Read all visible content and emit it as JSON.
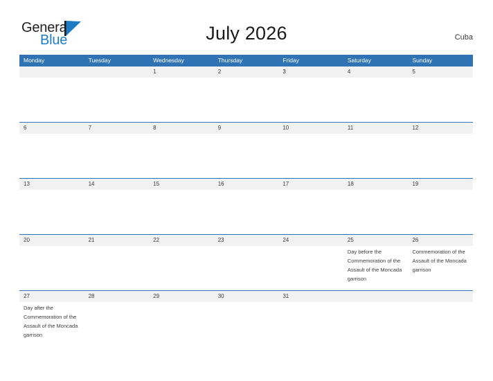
{
  "brand": {
    "name_part1": "General",
    "name_part2": "Blue",
    "flag_color": "#1f7ac4"
  },
  "header": {
    "title": "July 2026",
    "region": "Cuba"
  },
  "theme": {
    "header_blue": "#2f73b4",
    "band_gray": "#f1f1f1",
    "text_gray": "#3b3b3b"
  },
  "calendar": {
    "weekdays": [
      "Monday",
      "Tuesday",
      "Wednesday",
      "Thursday",
      "Friday",
      "Saturday",
      "Sunday"
    ],
    "weeks": [
      [
        {
          "day": "",
          "events": []
        },
        {
          "day": "",
          "events": []
        },
        {
          "day": "1",
          "events": []
        },
        {
          "day": "2",
          "events": []
        },
        {
          "day": "3",
          "events": []
        },
        {
          "day": "4",
          "events": []
        },
        {
          "day": "5",
          "events": []
        }
      ],
      [
        {
          "day": "6",
          "events": []
        },
        {
          "day": "7",
          "events": []
        },
        {
          "day": "8",
          "events": []
        },
        {
          "day": "9",
          "events": []
        },
        {
          "day": "10",
          "events": []
        },
        {
          "day": "11",
          "events": []
        },
        {
          "day": "12",
          "events": []
        }
      ],
      [
        {
          "day": "13",
          "events": []
        },
        {
          "day": "14",
          "events": []
        },
        {
          "day": "15",
          "events": []
        },
        {
          "day": "16",
          "events": []
        },
        {
          "day": "17",
          "events": []
        },
        {
          "day": "18",
          "events": []
        },
        {
          "day": "19",
          "events": []
        }
      ],
      [
        {
          "day": "20",
          "events": []
        },
        {
          "day": "21",
          "events": []
        },
        {
          "day": "22",
          "events": []
        },
        {
          "day": "23",
          "events": []
        },
        {
          "day": "24",
          "events": []
        },
        {
          "day": "25",
          "events": [
            "Day before the Commemoration of the Assault of the Moncada garrison"
          ]
        },
        {
          "day": "26",
          "events": [
            "Commemoration of the Assault of the Moncada garrison"
          ]
        }
      ],
      [
        {
          "day": "27",
          "events": [
            "Day after the Commemoration of the Assault of the Moncada garrison"
          ]
        },
        {
          "day": "28",
          "events": []
        },
        {
          "day": "29",
          "events": []
        },
        {
          "day": "30",
          "events": []
        },
        {
          "day": "31",
          "events": []
        },
        {
          "day": "",
          "events": []
        },
        {
          "day": "",
          "events": []
        }
      ]
    ]
  }
}
